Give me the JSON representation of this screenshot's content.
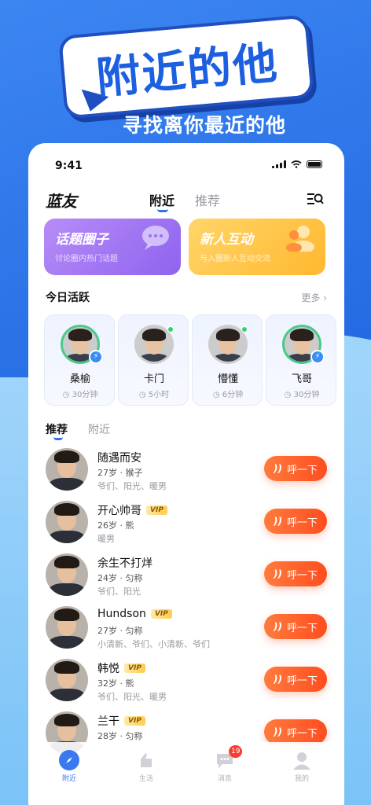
{
  "promo": {
    "title": "附近的他",
    "subtitle": "寻找离你最近的他"
  },
  "status_bar": {
    "time": "9:41"
  },
  "header": {
    "brand": "蓝友",
    "tabs": [
      {
        "label": "附近"
      },
      {
        "label": "推荐"
      }
    ]
  },
  "feature_cards": [
    {
      "title": "话题圈子",
      "subtitle": "讨论圈内热门话题"
    },
    {
      "title": "新人互动",
      "subtitle": "与入圈新人互动交流"
    }
  ],
  "today_active": {
    "title": "今日活跃",
    "more_label": "更多",
    "items": [
      {
        "name": "桑榆",
        "time": "30分钟"
      },
      {
        "name": "卡门",
        "time": "5小时"
      },
      {
        "name": "懵懂",
        "time": "6分钟"
      },
      {
        "name": "飞哥",
        "time": "30分钟"
      }
    ]
  },
  "list_tabs": [
    {
      "label": "推荐"
    },
    {
      "label": "附近"
    }
  ],
  "users": [
    {
      "name": "随遇而安",
      "vip": "",
      "meta": "27岁 · 猴子",
      "tags": "爷们、阳光、暖男",
      "button": "呼一下"
    },
    {
      "name": "开心帅哥",
      "vip": "VIP",
      "meta": "26岁 · 熊",
      "tags": "暖男",
      "button": "呼一下"
    },
    {
      "name": "余生不打烊",
      "vip": "",
      "meta": "24岁 · 匀称",
      "tags": "爷们、阳光",
      "button": "呼一下"
    },
    {
      "name": "Hundson",
      "vip": "VIP",
      "meta": "27岁 · 匀称",
      "tags": "小清新、爷们、小清新、爷们",
      "button": "呼一下"
    },
    {
      "name": "韩悦",
      "vip": "VIP",
      "meta": "32岁 · 熊",
      "tags": "爷们、阳光、暖男",
      "button": "呼一下"
    },
    {
      "name": "兰干",
      "vip": "VIP",
      "meta": "28岁 · 匀称",
      "tags": "",
      "button": "呼一下"
    }
  ],
  "tabbar": {
    "items": [
      {
        "label": "附近",
        "icon": "compass-icon"
      },
      {
        "label": "生活",
        "icon": "life-icon"
      },
      {
        "label": "消息",
        "icon": "message-icon",
        "badge": "19"
      },
      {
        "label": "我的",
        "icon": "profile-icon"
      }
    ]
  },
  "colors": {
    "accent_blue": "#2f6ff0",
    "call_orange": "#ff5a26",
    "online_green": "#2fd36b"
  }
}
